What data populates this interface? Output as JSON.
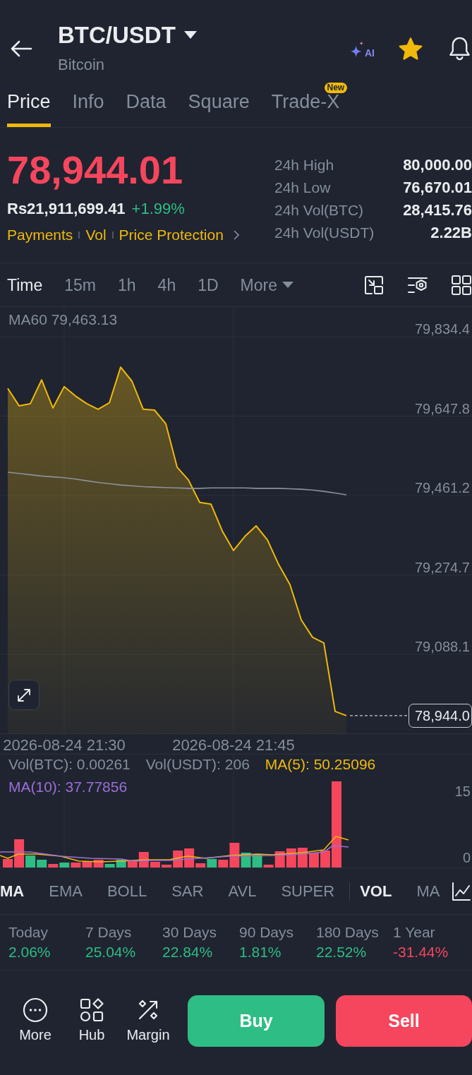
{
  "header": {
    "title": "BTC/USDT",
    "subtitle": "Bitcoin",
    "ai_label": "AI",
    "favorited": true
  },
  "tabs": [
    {
      "label": "Price",
      "selected": true
    },
    {
      "label": "Info",
      "selected": false
    },
    {
      "label": "Data",
      "selected": false
    },
    {
      "label": "Square",
      "selected": false
    },
    {
      "label": "Trade-X",
      "selected": false,
      "badge": "New"
    }
  ],
  "ticker": {
    "last_price": "78,944.01",
    "price_down": true,
    "fiat_price": "Rs21,911,699.41",
    "change": "+1.99%",
    "change_up": true,
    "links": [
      "Payments",
      "Vol",
      "Price Protection"
    ],
    "stats": [
      {
        "label": "24h High",
        "value": "80,000.00"
      },
      {
        "label": "24h Low",
        "value": "76,670.01"
      },
      {
        "label": "24h Vol(BTC)",
        "value": "28,415.76"
      },
      {
        "label": "24h Vol(USDT)",
        "value": "2.22B"
      }
    ]
  },
  "intervals": [
    {
      "label": "Time",
      "selected": true,
      "kind": "option"
    },
    {
      "label": "15m",
      "selected": false,
      "kind": "option"
    },
    {
      "label": "1h",
      "selected": false,
      "kind": "option"
    },
    {
      "label": "4h",
      "selected": false,
      "kind": "option"
    },
    {
      "label": "1D",
      "selected": false,
      "kind": "option"
    },
    {
      "label": "More",
      "selected": false,
      "kind": "dropdown"
    }
  ],
  "price_chart": {
    "legend": "MA60 79,463.13",
    "price_tag": "78,944.0",
    "chart_data": {
      "type": "area",
      "grid": true,
      "categories": [
        null,
        null,
        null,
        null,
        null,
        "2026-08-24 21:30",
        null,
        null,
        null,
        null,
        null,
        null,
        null,
        null,
        null,
        null,
        null,
        null,
        null,
        null,
        "2026-08-24 21:45",
        null,
        null,
        null,
        null,
        null,
        null,
        null,
        null,
        null,
        null
      ],
      "ylim": [
        78900.7,
        79904.1
      ],
      "yticks": [
        {
          "value": 79834.4,
          "label": "79,834.4"
        },
        {
          "value": 79647.8,
          "label": "79,647.8"
        },
        {
          "value": 79461.2,
          "label": "79,461.2"
        },
        {
          "value": 79274.7,
          "label": "79,274.7"
        },
        {
          "value": 79088.1,
          "label": "79,088.1"
        }
      ],
      "series": [
        {
          "type": "area",
          "color": "#f0b90b",
          "values": [
            79713,
            79672,
            79677,
            79733,
            79667,
            79717,
            79695,
            79677,
            79664,
            79679,
            79763,
            79730,
            79664,
            79662,
            79630,
            79528,
            79498,
            79445,
            79441,
            79378,
            79332,
            79365,
            79390,
            79357,
            79299,
            79252,
            79169,
            79128,
            79115,
            78954,
            78944
          ]
        },
        {
          "type": "line",
          "color": "#8c919b",
          "values": [
            79516,
            79513,
            79510,
            79507,
            79505,
            79503,
            79500,
            79496,
            79492,
            79489,
            79486,
            79484,
            79482,
            79481,
            79480,
            79479,
            79478,
            79478,
            79479,
            79479,
            79479,
            79479,
            79478,
            79478,
            79478,
            79477,
            79476,
            79474,
            79471,
            79467,
            79463
          ]
        }
      ]
    }
  },
  "volume_chart": {
    "legend": [
      {
        "text": "Vol(BTC): 0.00261",
        "color": "#848e9c"
      },
      {
        "text": "Vol(USDT): 206",
        "color": "#848e9c"
      },
      {
        "text": "MA(5): 50.25096",
        "color": "#f0b90b"
      },
      {
        "text": "MA(10): 37.77856",
        "color": "#9c6fd6"
      }
    ],
    "axis_labels": [
      "15",
      "0"
    ]
  },
  "indicators": {
    "main": [
      {
        "label": "MA",
        "selected": true
      },
      {
        "label": "EMA",
        "selected": false
      },
      {
        "label": "BOLL",
        "selected": false
      },
      {
        "label": "SAR",
        "selected": false
      },
      {
        "label": "AVL",
        "selected": false
      },
      {
        "label": "SUPER",
        "selected": false
      }
    ],
    "sub": [
      {
        "label": "VOL",
        "selected": true
      },
      {
        "label": "MA",
        "selected": false
      }
    ]
  },
  "periods": [
    {
      "label": "Today",
      "value": "2.06%",
      "color": "#2ebd85"
    },
    {
      "label": "7 Days",
      "value": "25.04%",
      "color": "#2ebd85"
    },
    {
      "label": "30 Days",
      "value": "22.84%",
      "color": "#2ebd85"
    },
    {
      "label": "90 Days",
      "value": "1.81%",
      "color": "#2ebd85"
    },
    {
      "label": "180 Days",
      "value": "22.52%",
      "color": "#2ebd85"
    },
    {
      "label": "1 Year",
      "value": "-31.44%",
      "color": "#f6465d"
    }
  ],
  "actions": [
    {
      "label": "More"
    },
    {
      "label": "Hub"
    },
    {
      "label": "Margin"
    }
  ],
  "trade_buttons": [
    {
      "label": "Buy",
      "kind": "buy"
    },
    {
      "label": "Sell",
      "kind": "sell"
    }
  ]
}
